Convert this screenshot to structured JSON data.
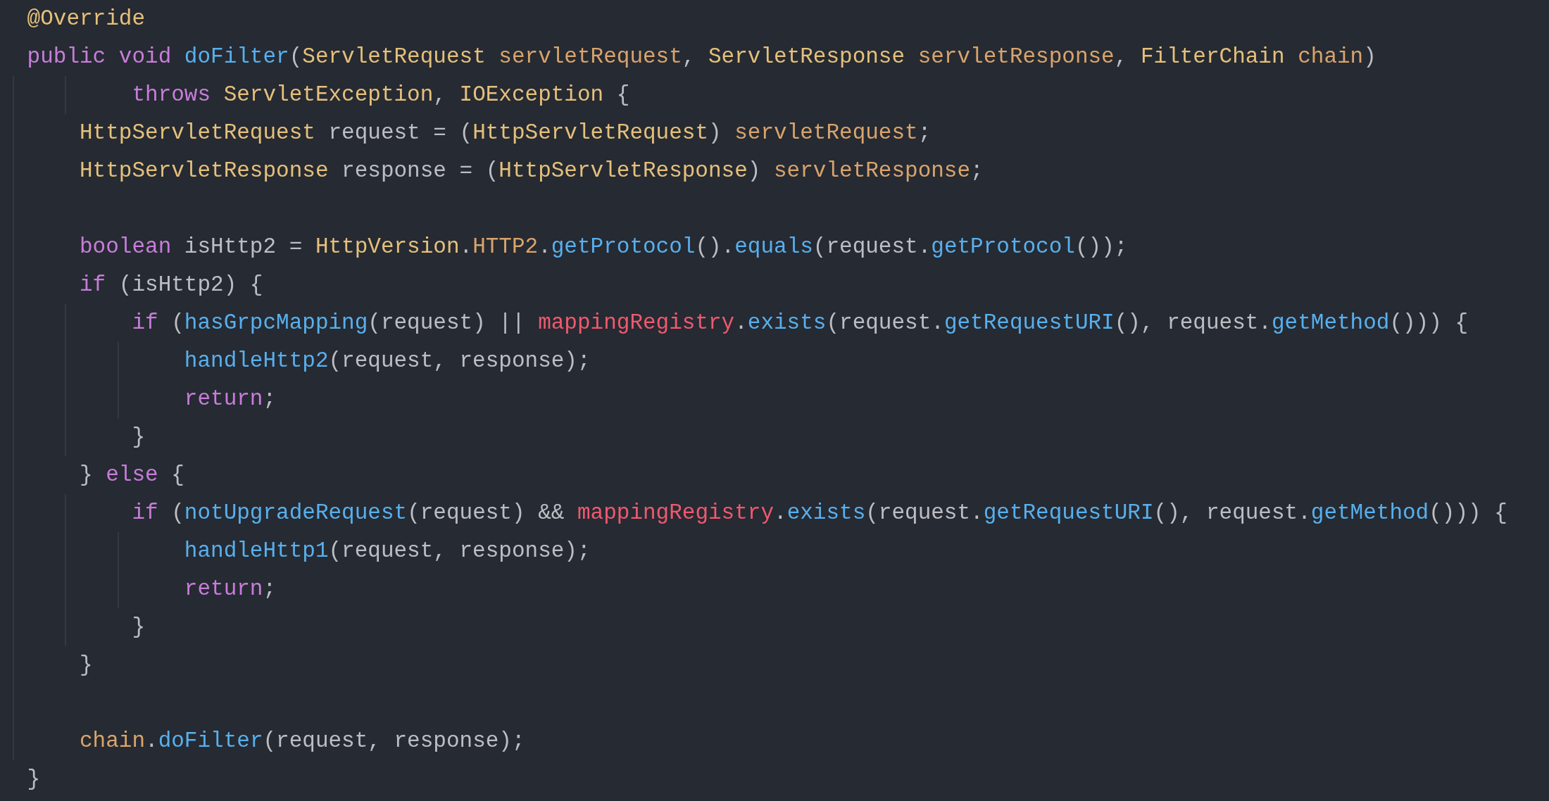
{
  "editor": {
    "lines": [
      {
        "tokens": [
          {
            "text": "@Override",
            "kind": "annotation"
          }
        ]
      },
      {
        "tokens": [
          {
            "text": "public void ",
            "kind": "keyword"
          },
          {
            "text": "doFilter",
            "kind": "function"
          },
          {
            "text": "(",
            "kind": "plain"
          },
          {
            "text": "ServletRequest",
            "kind": "type"
          },
          {
            "text": " servletRequest",
            "kind": "param"
          },
          {
            "text": ", ",
            "kind": "plain"
          },
          {
            "text": "ServletResponse",
            "kind": "type"
          },
          {
            "text": " servletResponse",
            "kind": "param"
          },
          {
            "text": ", ",
            "kind": "plain"
          },
          {
            "text": "FilterChain",
            "kind": "type"
          },
          {
            "text": " chain",
            "kind": "param"
          },
          {
            "text": ")",
            "kind": "plain"
          }
        ]
      },
      {
        "tokens": [
          {
            "text": "        throws",
            "kind": "keyword"
          },
          {
            "text": " ServletException",
            "kind": "type"
          },
          {
            "text": ", ",
            "kind": "plain"
          },
          {
            "text": "IOException",
            "kind": "type"
          },
          {
            "text": " {",
            "kind": "plain"
          }
        ]
      },
      {
        "tokens": [
          {
            "text": "    HttpServletRequest",
            "kind": "type"
          },
          {
            "text": " request = (",
            "kind": "plain"
          },
          {
            "text": "HttpServletRequest",
            "kind": "type"
          },
          {
            "text": ") ",
            "kind": "plain"
          },
          {
            "text": "servletRequest",
            "kind": "param"
          },
          {
            "text": ";",
            "kind": "plain"
          }
        ]
      },
      {
        "tokens": [
          {
            "text": "    HttpServletResponse",
            "kind": "type"
          },
          {
            "text": " response = (",
            "kind": "plain"
          },
          {
            "text": "HttpServletResponse",
            "kind": "type"
          },
          {
            "text": ") ",
            "kind": "plain"
          },
          {
            "text": "servletResponse",
            "kind": "param"
          },
          {
            "text": ";",
            "kind": "plain"
          }
        ]
      },
      {
        "kind": "blank"
      },
      {
        "tokens": [
          {
            "text": "    boolean",
            "kind": "keyword"
          },
          {
            "text": " isHttp2 = ",
            "kind": "plain"
          },
          {
            "text": "HttpVersion",
            "kind": "type"
          },
          {
            "text": ".",
            "kind": "plain"
          },
          {
            "text": "HTTP2",
            "kind": "constant"
          },
          {
            "text": ".",
            "kind": "plain"
          },
          {
            "text": "getProtocol",
            "kind": "call"
          },
          {
            "text": "().",
            "kind": "plain"
          },
          {
            "text": "equals",
            "kind": "call"
          },
          {
            "text": "(request.",
            "kind": "plain"
          },
          {
            "text": "getProtocol",
            "kind": "call"
          },
          {
            "text": "());",
            "kind": "plain"
          }
        ]
      },
      {
        "tokens": [
          {
            "text": "    if",
            "kind": "keyword"
          },
          {
            "text": " (isHttp2) {",
            "kind": "plain"
          }
        ]
      },
      {
        "tokens": [
          {
            "text": "        if",
            "kind": "keyword"
          },
          {
            "text": " (",
            "kind": "plain"
          },
          {
            "text": "hasGrpcMapping",
            "kind": "call"
          },
          {
            "text": "(request) || ",
            "kind": "plain"
          },
          {
            "text": "mappingRegistry",
            "kind": "field"
          },
          {
            "text": ".",
            "kind": "plain"
          },
          {
            "text": "exists",
            "kind": "call"
          },
          {
            "text": "(request.",
            "kind": "plain"
          },
          {
            "text": "getRequestURI",
            "kind": "call"
          },
          {
            "text": "(), request.",
            "kind": "plain"
          },
          {
            "text": "getMethod",
            "kind": "call"
          },
          {
            "text": "())) {",
            "kind": "plain"
          }
        ]
      },
      {
        "tokens": [
          {
            "text": "            handleHttp2",
            "kind": "call"
          },
          {
            "text": "(request, response);",
            "kind": "plain"
          }
        ]
      },
      {
        "tokens": [
          {
            "text": "            return",
            "kind": "keyword"
          },
          {
            "text": ";",
            "kind": "plain"
          }
        ]
      },
      {
        "tokens": [
          {
            "text": "        }",
            "kind": "plain"
          }
        ]
      },
      {
        "tokens": [
          {
            "text": "    } ",
            "kind": "plain"
          },
          {
            "text": "else",
            "kind": "keyword"
          },
          {
            "text": " {",
            "kind": "plain"
          }
        ]
      },
      {
        "tokens": [
          {
            "text": "        if",
            "kind": "keyword"
          },
          {
            "text": " (",
            "kind": "plain"
          },
          {
            "text": "notUpgradeRequest",
            "kind": "call"
          },
          {
            "text": "(request) && ",
            "kind": "plain"
          },
          {
            "text": "mappingRegistry",
            "kind": "field"
          },
          {
            "text": ".",
            "kind": "plain"
          },
          {
            "text": "exists",
            "kind": "call"
          },
          {
            "text": "(request.",
            "kind": "plain"
          },
          {
            "text": "getRequestURI",
            "kind": "call"
          },
          {
            "text": "(), request.",
            "kind": "plain"
          },
          {
            "text": "getMethod",
            "kind": "call"
          },
          {
            "text": "())) {",
            "kind": "plain"
          }
        ]
      },
      {
        "tokens": [
          {
            "text": "            handleHttp1",
            "kind": "call"
          },
          {
            "text": "(request, response);",
            "kind": "plain"
          }
        ]
      },
      {
        "tokens": [
          {
            "text": "            return",
            "kind": "keyword"
          },
          {
            "text": ";",
            "kind": "plain"
          }
        ]
      },
      {
        "tokens": [
          {
            "text": "        }",
            "kind": "plain"
          }
        ]
      },
      {
        "tokens": [
          {
            "text": "    }",
            "kind": "plain"
          }
        ]
      },
      {
        "kind": "blank"
      },
      {
        "tokens": [
          {
            "text": "    chain",
            "kind": "param"
          },
          {
            "text": ".",
            "kind": "plain"
          },
          {
            "text": "doFilter",
            "kind": "call"
          },
          {
            "text": "(request, response);",
            "kind": "plain"
          }
        ]
      },
      {
        "tokens": [
          {
            "text": "}",
            "kind": "plain"
          }
        ]
      }
    ]
  }
}
